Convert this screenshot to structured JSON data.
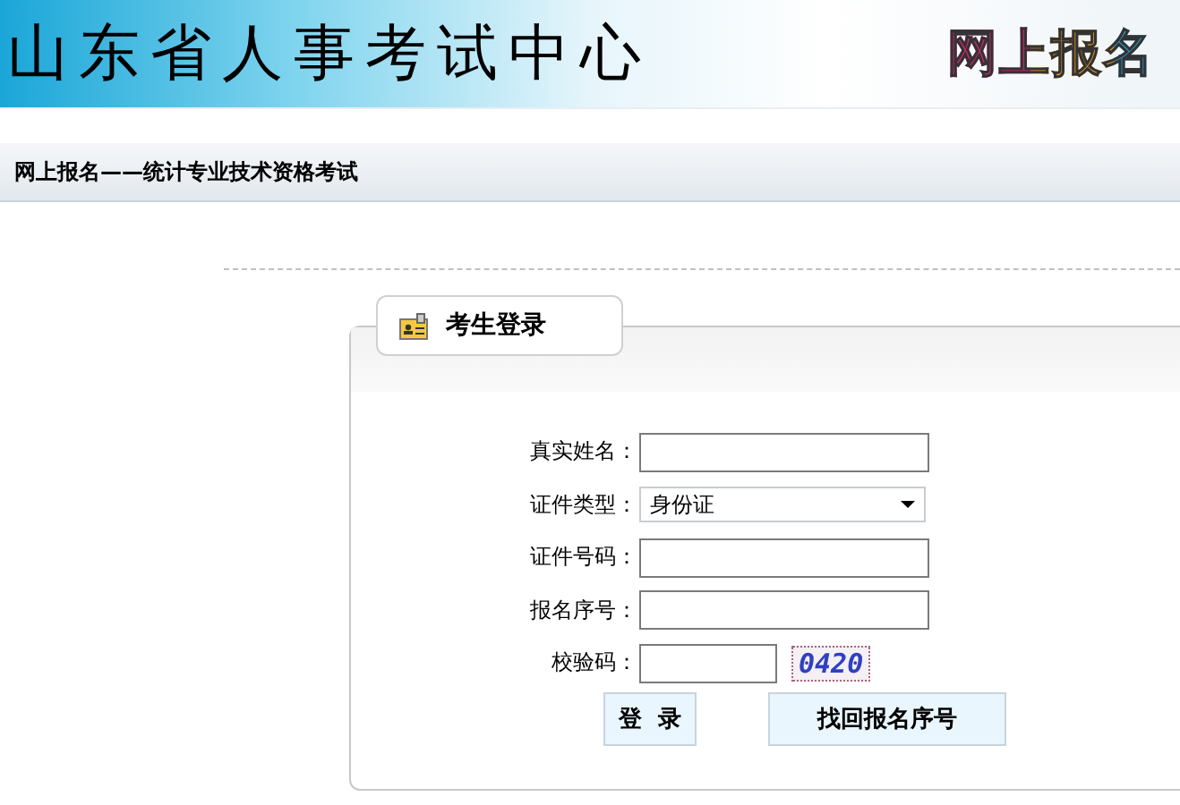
{
  "header": {
    "title": "山东省人事考试中心",
    "logo_text": "网上报名"
  },
  "breadcrumb": "网上报名——统计专业技术资格考试",
  "login_panel": {
    "title": "考生登录",
    "fields": [
      {
        "kind": "text",
        "label": "真实姓名："
      },
      {
        "kind": "select",
        "label": "证件类型：",
        "value": "身份证"
      },
      {
        "kind": "text",
        "label": "证件号码："
      },
      {
        "kind": "text",
        "label": "报名序号："
      },
      {
        "kind": "captcha",
        "label": "校验码：",
        "captcha": "0420"
      }
    ],
    "buttons": [
      "登  录",
      "找回报名序号"
    ]
  }
}
